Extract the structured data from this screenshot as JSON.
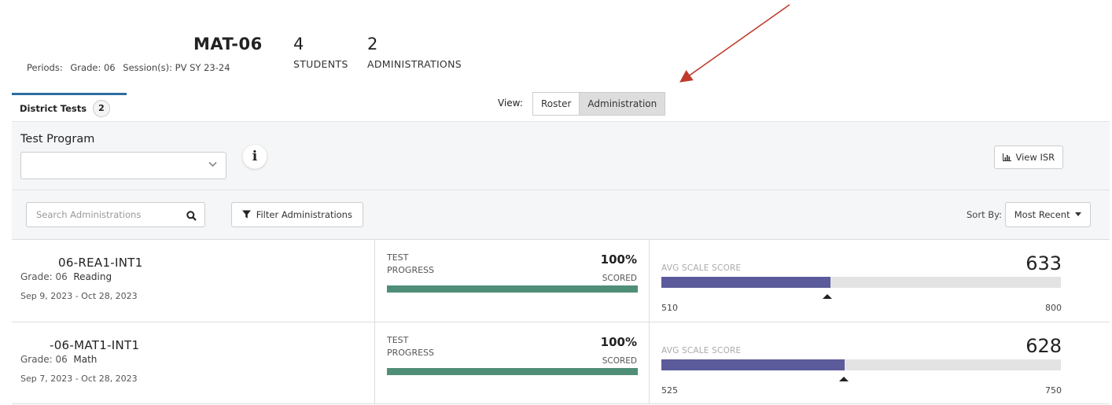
{
  "header": {
    "class_name": "MAT-06",
    "periods_label": "Periods:",
    "grade_label": "Grade: 06",
    "session_label": "Session(s): PV SY 23-24",
    "students_count": "4",
    "students_label": "STUDENTS",
    "administrations_count": "2",
    "administrations_label": "ADMINISTRATIONS"
  },
  "tabs": {
    "district_tests_label": "District Tests",
    "district_tests_count": "2"
  },
  "view": {
    "label": "View:",
    "options": [
      "Roster",
      "Administration"
    ],
    "selected": "Administration"
  },
  "filters": {
    "test_program_label": "Test Program",
    "test_program_value": "",
    "view_isr_label": "View ISR",
    "search_placeholder": "Search Administrations",
    "filter_button_label": "Filter Administrations",
    "sort_by_label": "Sort By:",
    "sort_value": "Most Recent"
  },
  "administrations": [
    {
      "name": "06-REA1-INT1",
      "grade": "Grade: 06",
      "subject": "Reading",
      "dates": "Sep 9, 2023 - Oct 28, 2023",
      "progress_label_1": "TEST",
      "progress_label_2": "PROGRESS",
      "progress_pct": "100%",
      "progress_value": 1.0,
      "scored_label": "SCORED",
      "avg_label": "AVG SCALE SCORE",
      "avg_score": "633",
      "score_value": 633,
      "scale_min": "510",
      "scale_max": "800"
    },
    {
      "name": "-06-MAT1-INT1",
      "grade": "Grade: 06",
      "subject": "Math",
      "dates": "Sep 7, 2023 - Oct 28, 2023",
      "progress_label_1": "TEST",
      "progress_label_2": "PROGRESS",
      "progress_pct": "100%",
      "progress_value": 1.0,
      "scored_label": "SCORED",
      "avg_label": "AVG SCALE SCORE",
      "avg_score": "628",
      "score_value": 628,
      "scale_min": "525",
      "scale_max": "750"
    }
  ],
  "colors": {
    "tab_accent": "#2c6ea1",
    "progress_fill": "#4f8e77",
    "score_fill": "#5b5a9a",
    "annotation_arrow": "#c0392b"
  },
  "icons": {
    "chevron": "chevron-down-icon",
    "info": "info-icon",
    "chart": "bar-chart-icon",
    "search": "search-icon",
    "filter": "filter-icon",
    "caret": "caret-down-icon",
    "marker": "triangle-marker-icon",
    "annotation": "annotation-arrow-icon"
  }
}
